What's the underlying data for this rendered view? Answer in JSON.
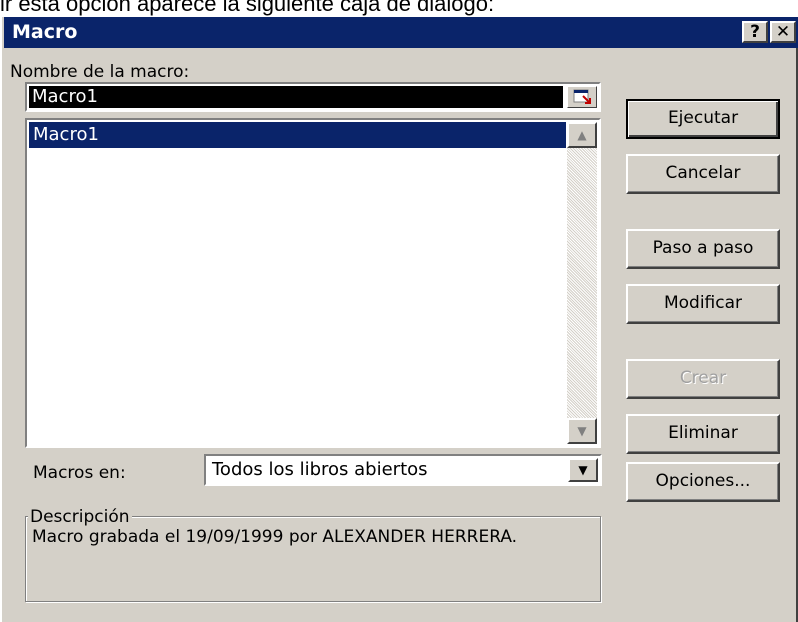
{
  "caption": "ir esta opción aparece la siguiente caja de diálogo:",
  "window": {
    "title": "Macro",
    "help_label": "?",
    "close_label": "✕"
  },
  "macro_name": {
    "label": "Nombre de la macro:",
    "value": "Macro1",
    "collapse_icon": "collapse-dialog-icon"
  },
  "macro_list": {
    "items": [
      "Macro1"
    ],
    "selected": "Macro1"
  },
  "macros_in": {
    "label": "Macros en:",
    "value": "Todos los libros abiertos"
  },
  "description": {
    "legend": "Descripción",
    "text": "Macro grabada el 19/09/1999 por ALEXANDER HERRERA."
  },
  "buttons": {
    "run": "Ejecutar",
    "cancel": "Cancelar",
    "step_into": "Paso a paso",
    "edit": "Modificar",
    "create": "Crear",
    "delete": "Eliminar",
    "options": "Opciones..."
  },
  "colors": {
    "titlebar": "#0a246a",
    "face": "#d4d0c8",
    "selection": "#0a246a"
  }
}
